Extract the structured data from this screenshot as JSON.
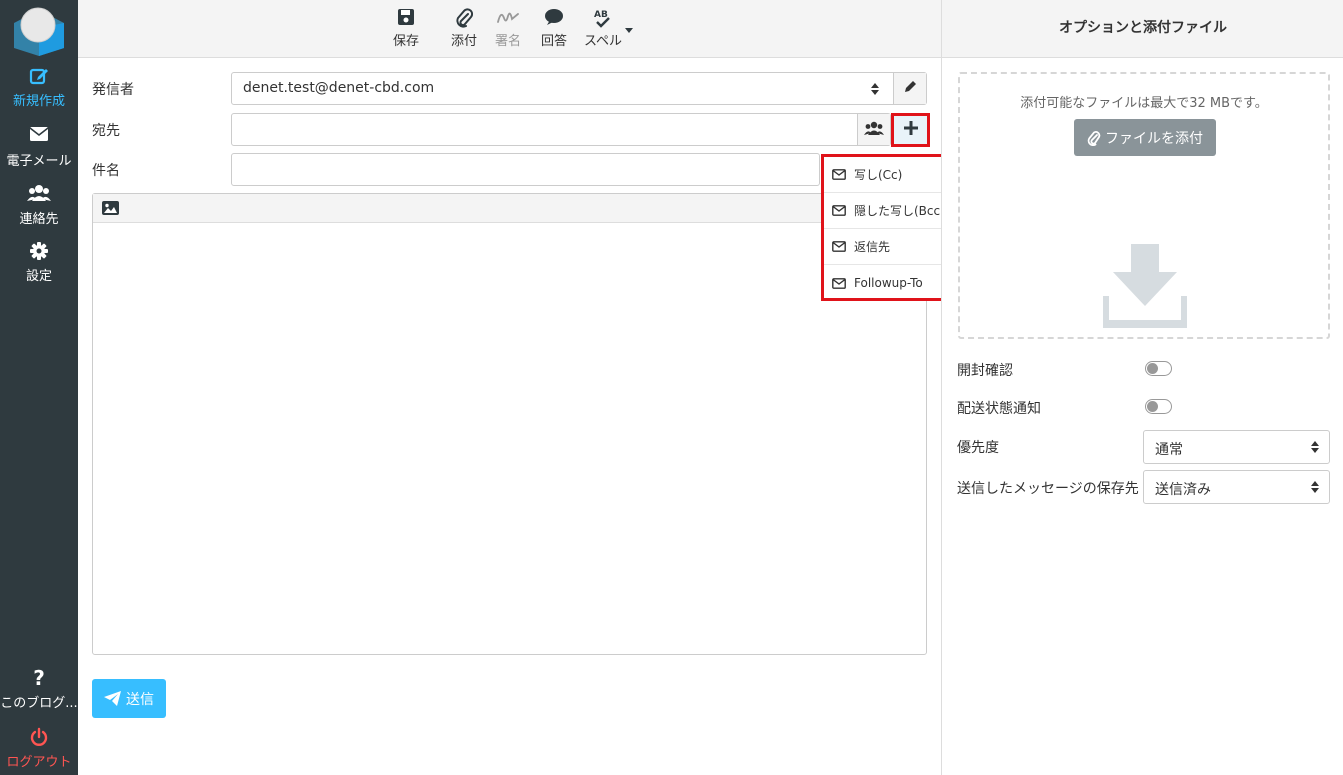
{
  "sidebar": {
    "items": [
      {
        "label": "新規作成",
        "icon": "compose-icon",
        "active": true
      },
      {
        "label": "電子メール",
        "icon": "envelope-icon"
      },
      {
        "label": "連絡先",
        "icon": "contacts-icon"
      },
      {
        "label": "設定",
        "icon": "gear-icon"
      },
      {
        "label": "このブログ...",
        "icon": "question-icon"
      },
      {
        "label": "ログアウト",
        "icon": "power-icon"
      }
    ]
  },
  "toolbar": {
    "save": "保存",
    "attach": "添付",
    "signature": "署名",
    "responses": "回答",
    "spell": "スペル"
  },
  "form": {
    "from_label": "発信者",
    "from_value": "denet.test@denet-cbd.com",
    "to_label": "宛先",
    "to_value": "",
    "subject_label": "件名",
    "subject_value": ""
  },
  "add_menu": {
    "items": [
      "写し(Cc)",
      "隠した写し(Bcc)",
      "返信先",
      "Followup-To"
    ]
  },
  "send_button": "送信",
  "right_panel": {
    "title": "オプションと添付ファイル",
    "attach_hint": "添付可能なファイルは最大で32 MBです。",
    "attach_button": "ファイルを添付",
    "read_receipt_label": "開封確認",
    "dsn_label": "配送状態通知",
    "priority_label": "優先度",
    "priority_value": "通常",
    "store_label": "送信したメッセージの保存先",
    "store_value": "送信済み"
  },
  "colors": {
    "sidebar_bg": "#2f3a3f",
    "accent": "#37beff",
    "logout": "#ff5552",
    "highlight_border": "#e0131a"
  }
}
